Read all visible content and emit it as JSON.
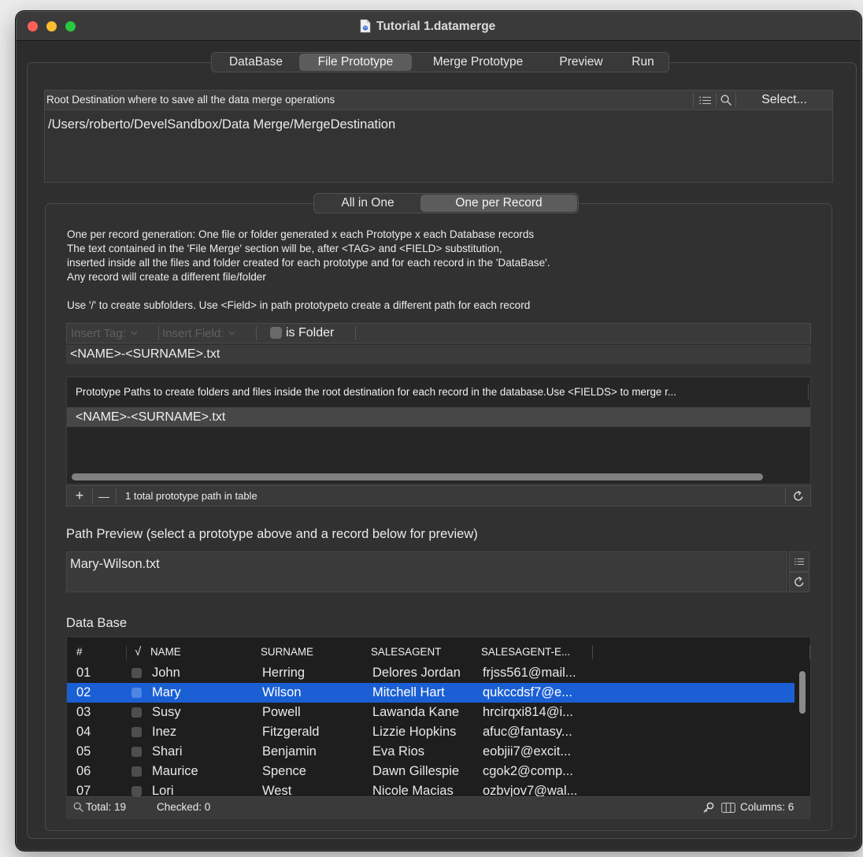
{
  "window": {
    "title": "Tutorial 1.datamerge",
    "document_icon": "datamerge-document-icon"
  },
  "main_tabs": [
    {
      "label": "DataBase",
      "selected": false
    },
    {
      "label": "File Prototype",
      "selected": true
    },
    {
      "label": "Merge Prototype",
      "selected": false
    },
    {
      "label": "Preview",
      "selected": false
    },
    {
      "label": "Run",
      "selected": false
    }
  ],
  "root_destination": {
    "header": "Root Destination where to save all the data merge operations",
    "list_icon": "list-icon",
    "search_icon": "search-icon",
    "select_label": "Select...",
    "path": "/Users/roberto/DevelSandbox/Data Merge/MergeDestination"
  },
  "mode_tabs": [
    {
      "label": "All in One",
      "selected": false
    },
    {
      "label": "One per Record",
      "selected": true
    }
  ],
  "description": [
    "One per record generation: One file or folder  generated x each Prototype x each Database records",
    "The text contained in the 'File Merge' section will be, after <TAG> and <FIELD> substitution,",
    "inserted inside all the files and folder created for each prototype and for each record in the 'DataBase'.",
    "Any record will create a different file/folder"
  ],
  "subfolder_hint": "Use '/' to create subfolders.  Use <Field> in path prototypeto create a different path for each record",
  "path_toolbar": {
    "insert_tag": "Insert Tag:",
    "insert_tag_enabled": false,
    "insert_field": "Insert Field:",
    "insert_field_enabled": false,
    "is_folder": "is Folder",
    "is_folder_checked": false
  },
  "path_input": {
    "value": "<NAME>-<SURNAME>.txt"
  },
  "prototype_table": {
    "header": "Prototype Paths to create folders and  files inside the root destination for each record in the database.Use <FIELDS> to merge r...",
    "rows": [
      "<NAME>-<SURNAME>.txt"
    ],
    "add_label": "+",
    "remove_label": "—",
    "status": "1 total prototype path in table",
    "refresh_icon": "refresh-icon"
  },
  "path_preview": {
    "label": "Path Preview (select a prototype above and a record below for preview)",
    "value": "Mary-Wilson.txt"
  },
  "database": {
    "label": "Data Base",
    "columns": {
      "num": "#",
      "check": "√",
      "name": "NAME",
      "surname": "SURNAME",
      "salesagent": "SALESAGENT",
      "email": "SALESAGENT-E..."
    },
    "rows": [
      {
        "num": "01",
        "checked": false,
        "selected": false,
        "name": "John",
        "surname": "Herring",
        "salesagent": "Delores Jordan",
        "email": "frjss561@mail..."
      },
      {
        "num": "02",
        "checked": false,
        "selected": true,
        "name": "Mary",
        "surname": "Wilson",
        "salesagent": "Mitchell Hart",
        "email": "qukccdsf7@e..."
      },
      {
        "num": "03",
        "checked": false,
        "selected": false,
        "name": "Susy",
        "surname": "Powell",
        "salesagent": "Lawanda Kane",
        "email": "hrcirqxi814@i..."
      },
      {
        "num": "04",
        "checked": false,
        "selected": false,
        "name": "Inez",
        "surname": "Fitzgerald",
        "salesagent": "Lizzie Hopkins",
        "email": "afuc@fantasy..."
      },
      {
        "num": "05",
        "checked": false,
        "selected": false,
        "name": "Shari",
        "surname": "Benjamin",
        "salesagent": "Eva Rios",
        "email": "eobjii7@excit..."
      },
      {
        "num": "06",
        "checked": false,
        "selected": false,
        "name": "Maurice",
        "surname": "Spence",
        "salesagent": "Dawn Gillespie",
        "email": "cgok2@comp..."
      },
      {
        "num": "07",
        "checked": false,
        "selected": false,
        "name": "Lori",
        "surname": "West",
        "salesagent": "Nicole Macias",
        "email": "ozbvjov7@wal..."
      }
    ],
    "footer": {
      "total": "Total: 19",
      "checked": "Checked: 0",
      "columns": "Columns: 6"
    }
  },
  "colors": {
    "selection": "#1b5fd5",
    "close": "#ff5f57",
    "minimize": "#febc2e",
    "zoom": "#28c840"
  }
}
